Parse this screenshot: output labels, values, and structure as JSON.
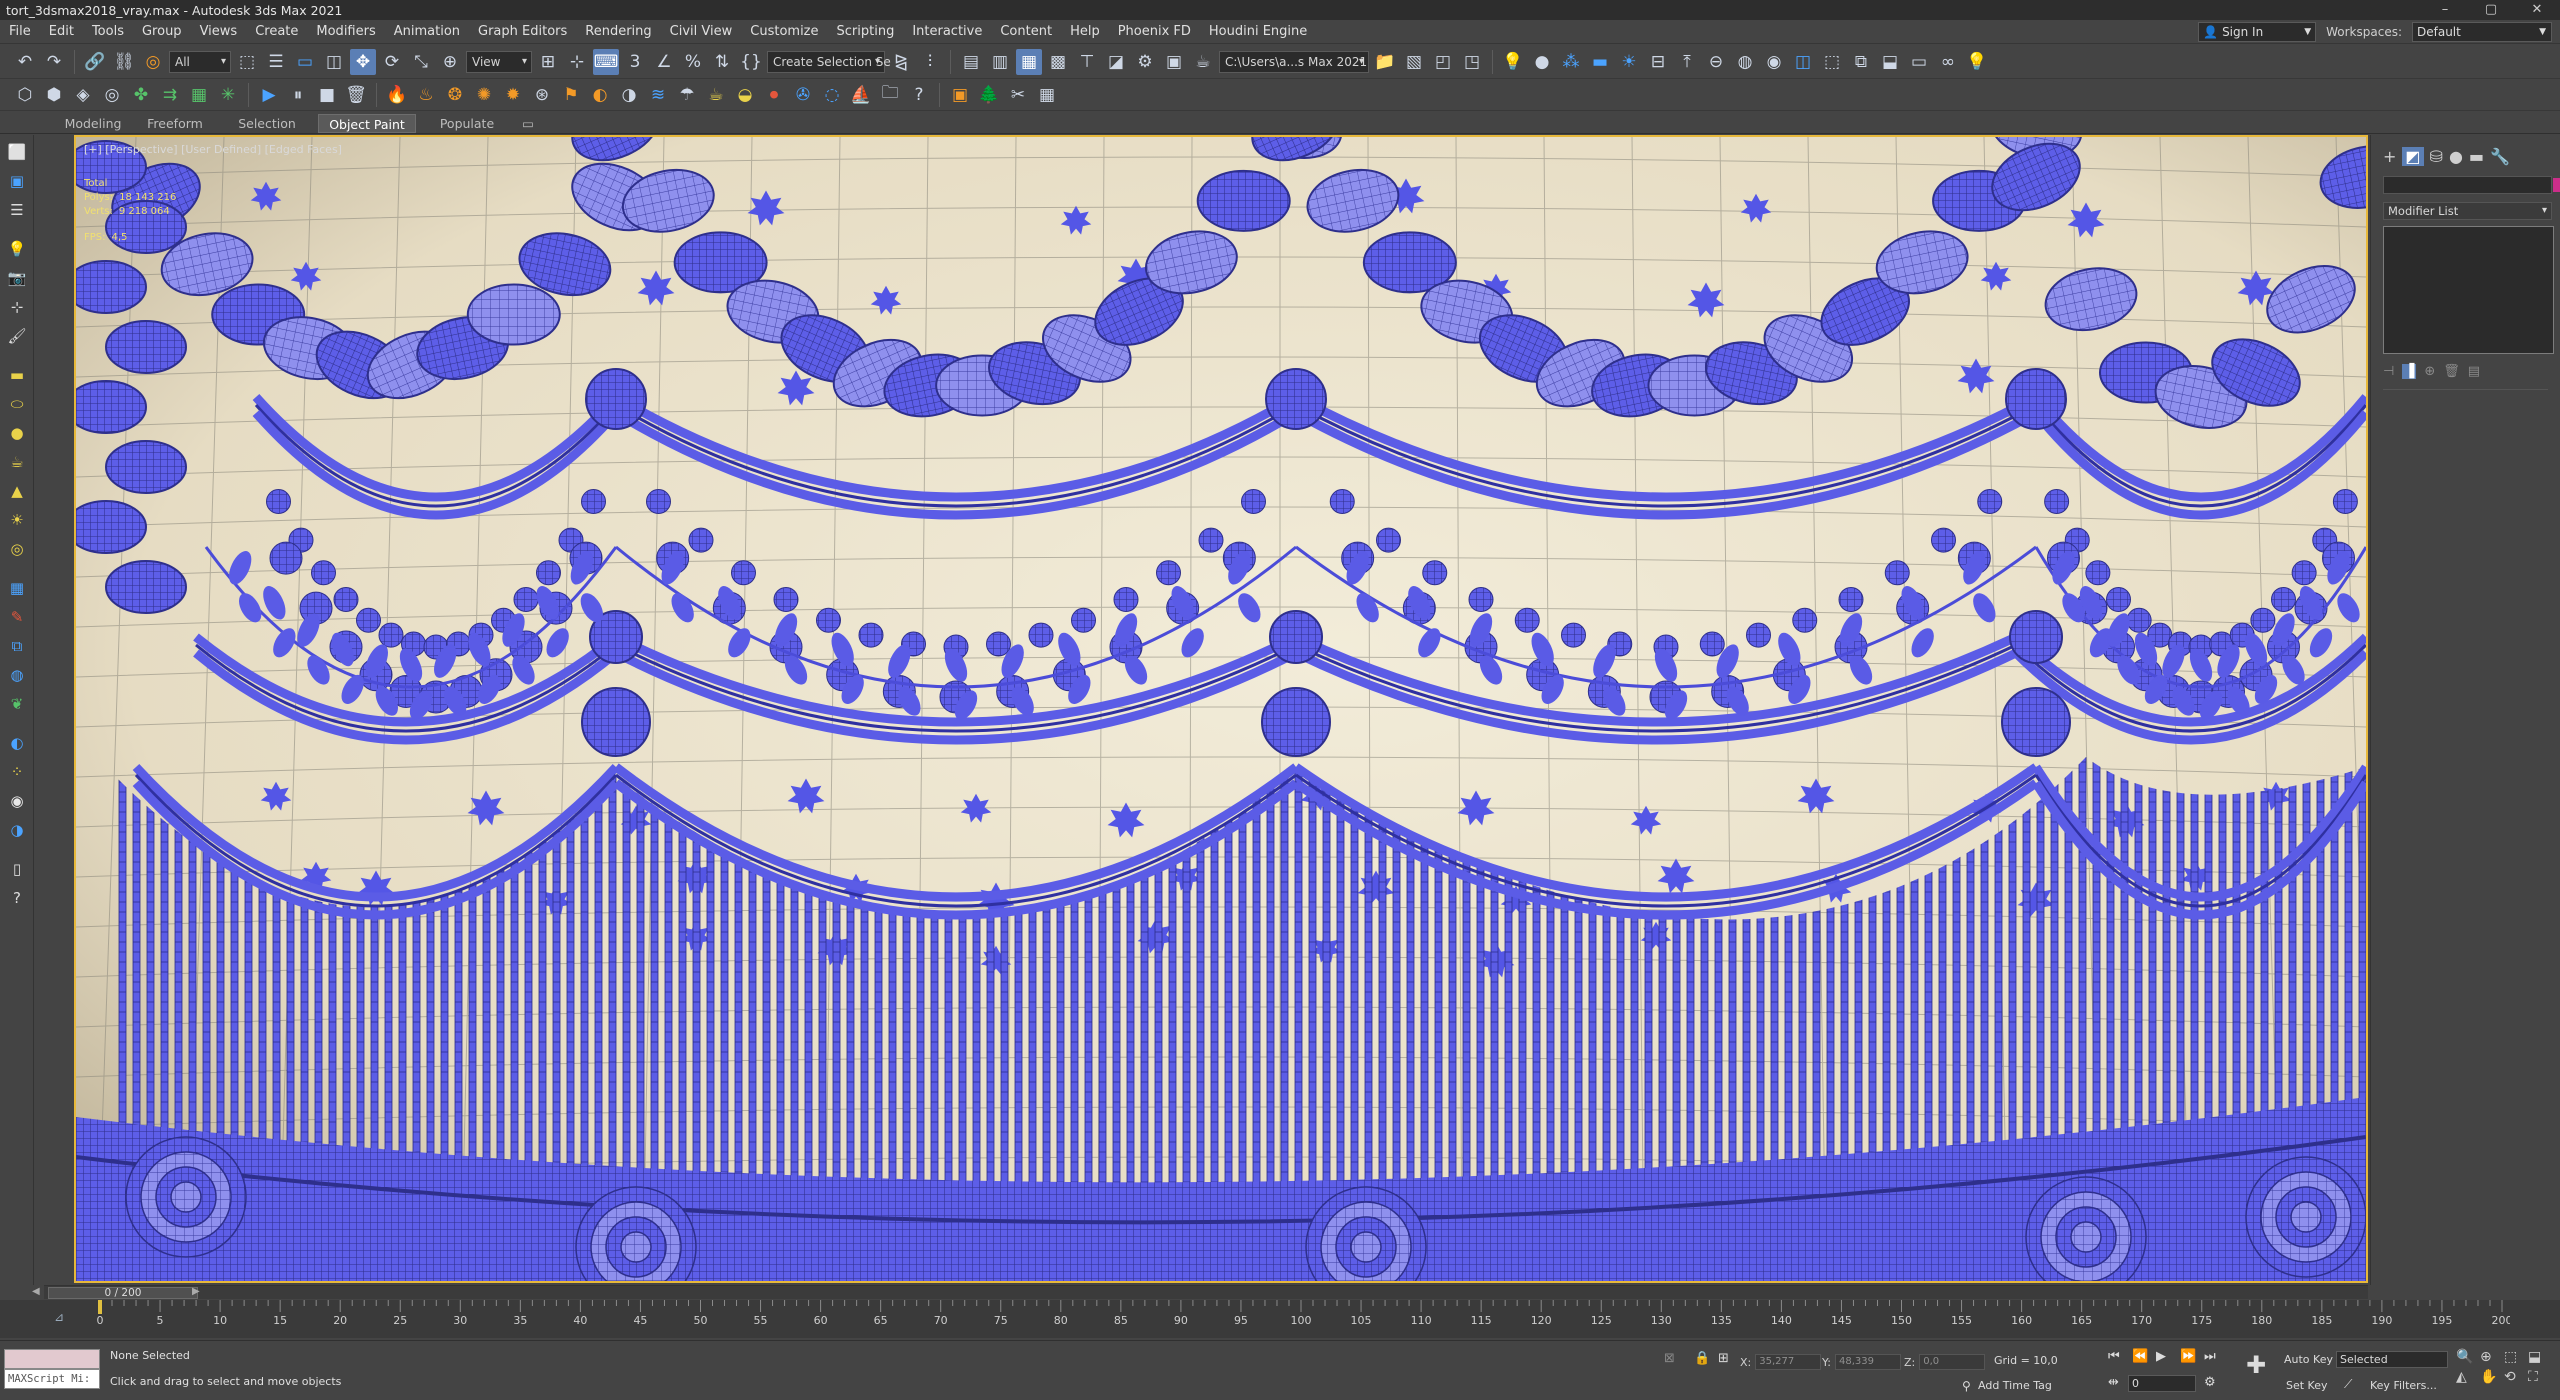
{
  "window": {
    "title": "tort_3dsmax2018_vray.max - Autodesk 3ds Max 2021",
    "min_label": "–",
    "max_label": "▢",
    "close_label": "✕"
  },
  "menu": [
    "File",
    "Edit",
    "Tools",
    "Group",
    "Views",
    "Create",
    "Modifiers",
    "Animation",
    "Graph Editors",
    "Rendering",
    "Civil View",
    "Customize",
    "Scripting",
    "Interactive",
    "Content",
    "Help",
    "Phoenix FD",
    "Houdini Engine"
  ],
  "account": {
    "sign_in": "Sign In",
    "workspaces_label": "Workspaces:",
    "workspace": "Default"
  },
  "toolbar": {
    "selection_filter": "All",
    "ref_coord": "View",
    "named_selection": "Create Selection Se",
    "project_path": "C:\\Users\\a...s Max 2021"
  },
  "ribbon": [
    "Modeling",
    "Freeform",
    "Selection",
    "Object Paint",
    "Populate"
  ],
  "ribbon_active": "Object Paint",
  "viewport": {
    "label": "[+] [Perspective] [User Defined] [Edged Faces]",
    "stats": [
      {
        "k": "Total",
        "v": ""
      },
      {
        "k": "Polys:",
        "v": "18 143 216"
      },
      {
        "k": "Verts:",
        "v": "9 218 064"
      },
      {
        "k": "FPS:",
        "v": "4,5"
      }
    ],
    "colors": {
      "wire": "#5b5ce6",
      "background": "#e9e1cb",
      "grid": "#8d8a7e"
    }
  },
  "command_panel": {
    "modifier_list": "Modifier List",
    "tabs": [
      "+",
      "◩",
      "⛁",
      "●",
      "▬",
      "🔧"
    ]
  },
  "timeline": {
    "slider": "0 / 200",
    "ticks": [
      0,
      5,
      10,
      15,
      20,
      25,
      30,
      35,
      40,
      45,
      50,
      55,
      60,
      65,
      70,
      75,
      80,
      85,
      90,
      95,
      100,
      105,
      110,
      115,
      120,
      125,
      130,
      135,
      140,
      145,
      150,
      155,
      160,
      165,
      170,
      175,
      180,
      185,
      190,
      195,
      200
    ],
    "range_end": 200
  },
  "status": {
    "maxscript": "MAXScript Mi:",
    "selection": "None Selected",
    "prompt": "Click and drag to select and move objects",
    "x_label": "X:",
    "x_value": "35,277",
    "y_label": "Y:",
    "y_value": "48,339",
    "z_label": "Z:",
    "z_value": "0,0",
    "grid": "Grid = 10,0",
    "add_time_tag": "Add Time Tag",
    "auto_key": "Auto Key",
    "set_key": "Set Key",
    "selected": "Selected",
    "key_filters": "Key Filters...",
    "frame": "0"
  }
}
